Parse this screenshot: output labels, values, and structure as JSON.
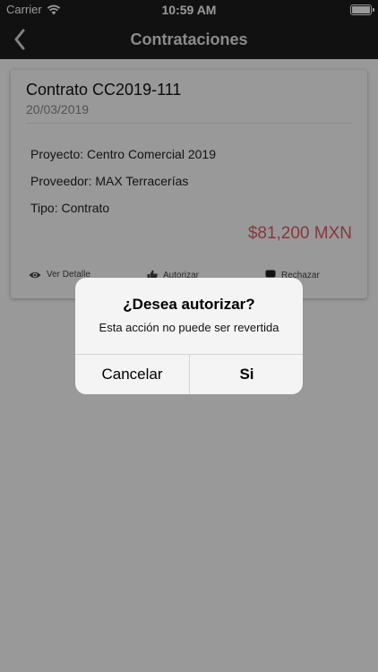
{
  "status_bar": {
    "carrier": "Carrier",
    "time": "10:59 AM",
    "battery_level": 1.0
  },
  "nav": {
    "title": "Contrataciones",
    "back_icon": "chevron-left-icon"
  },
  "card": {
    "title": "Contrato CC2019-111",
    "date": "20/03/2019",
    "proyecto": "Proyecto: Centro Comercial 2019",
    "proveedor": "Proveedor: MAX Terracerías",
    "tipo": "Tipo: Contrato",
    "amount": "$81,200 MXN",
    "amount_color": "#e35d6a",
    "actions": [
      {
        "label": "Ver Detalle",
        "icon": "eye-icon"
      },
      {
        "label": "Autorizar",
        "icon": "thumbs-up-icon"
      },
      {
        "label": "Rechazar",
        "icon": "thumbs-down-icon"
      }
    ]
  },
  "alert": {
    "title": "¿Desea autorizar?",
    "message": "Esta acción no puede ser revertida",
    "cancel_label": "Cancelar",
    "confirm_label": "Si"
  },
  "colors": {
    "bar": "#1d1d1f",
    "overlay": "rgba(0,0,0,0.4)"
  }
}
